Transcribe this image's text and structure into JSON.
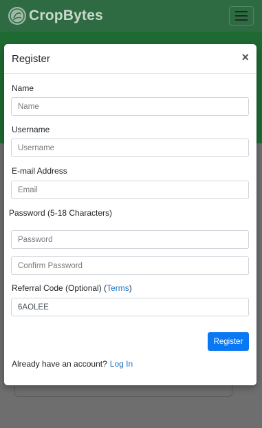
{
  "navbar": {
    "brand": "CropBytes",
    "logo_icon": "leaf-globe-icon",
    "menu_icon": "hamburger-icon"
  },
  "modal": {
    "title": "Register",
    "close_label": "×",
    "fields": {
      "name": {
        "label": "Name",
        "placeholder": "Name",
        "value": ""
      },
      "username": {
        "label": "Username",
        "placeholder": "Username",
        "value": ""
      },
      "email": {
        "label": "E-mail Address",
        "placeholder": "Email",
        "value": ""
      },
      "password": {
        "label": "Password (5-18 Characters)",
        "placeholder": "Password",
        "value": ""
      },
      "confirm_password": {
        "placeholder": "Confirm Password",
        "value": ""
      },
      "referral": {
        "label": "Referral Code (Optional) (",
        "terms_label": "Terms",
        "label_suffix": ")",
        "placeholder": "",
        "value": "6AOLEE"
      }
    },
    "register_label": "Register",
    "login_prompt": "Already have an account?",
    "login_link": "Log In"
  },
  "colors": {
    "navbar": "#2e6b43",
    "hero": "#1f6a32",
    "primary_button": "#0a78f2",
    "link": "#1a73c9"
  }
}
